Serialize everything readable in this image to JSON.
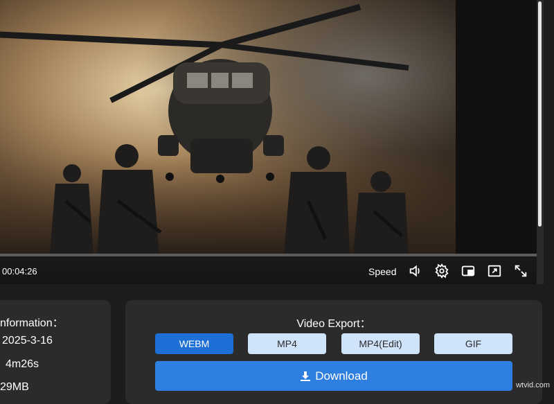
{
  "player": {
    "time": "00:04:26",
    "speed_label": "Speed",
    "icons": [
      "volume-icon",
      "settings-gear-icon",
      "picture-in-picture-icon",
      "window-fullscreen-icon",
      "fullscreen-expand-icon"
    ]
  },
  "info": {
    "title": "nformation：",
    "date": "2025-3-16",
    "duration": "4m26s",
    "size": "29MB"
  },
  "export": {
    "title": "Video Export：",
    "formats": [
      "WEBM",
      "MP4",
      "MP4(Edit)",
      "GIF"
    ],
    "selected": "WEBM",
    "download_label": "Download",
    "accent": "#1e6fd6",
    "inactive_color": "#cfe3fb"
  },
  "watermark": "wtvid.com"
}
